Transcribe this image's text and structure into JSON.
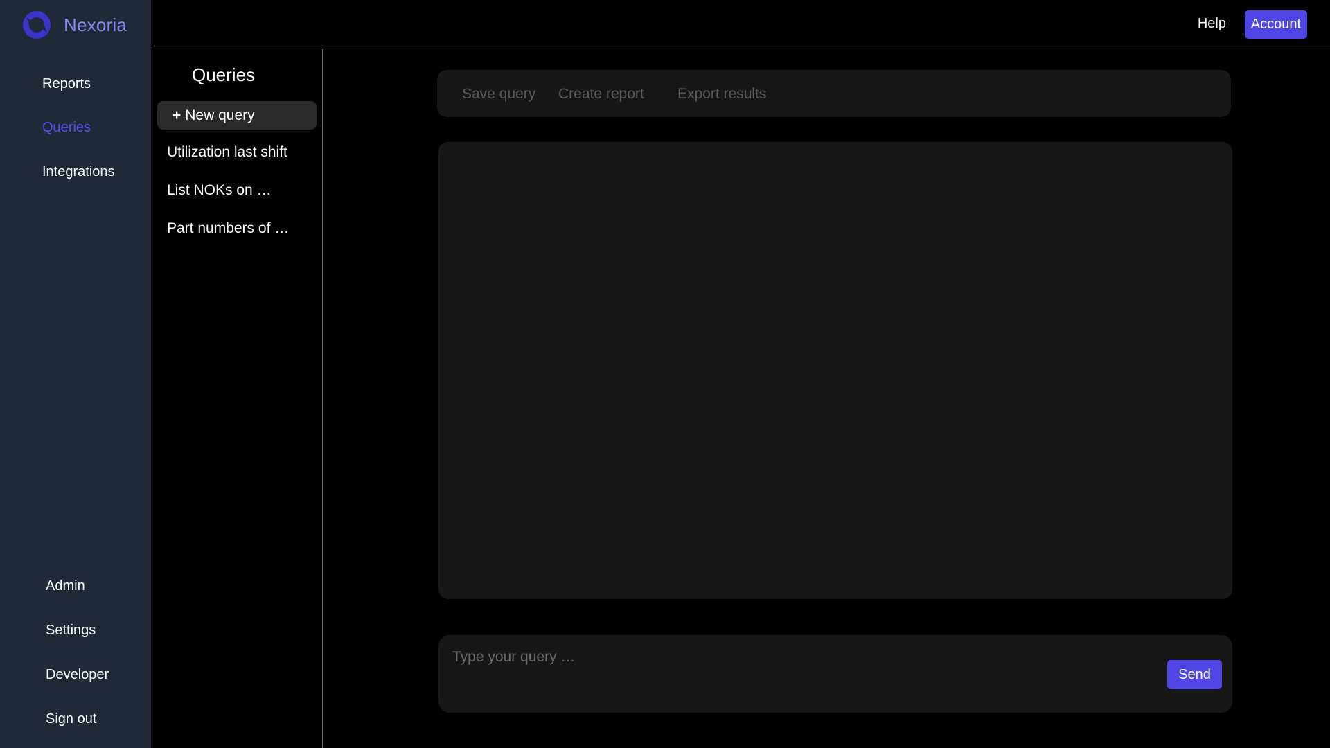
{
  "brand": {
    "name": "Nexoria",
    "logo_icon": "nexoria-logo-icon"
  },
  "sidebar": {
    "top_items": [
      {
        "label": "Reports"
      },
      {
        "label": "Queries",
        "active": true
      },
      {
        "label": "Integrations"
      }
    ],
    "bottom_items": [
      {
        "label": "Admin"
      },
      {
        "label": "Settings"
      },
      {
        "label": "Developer"
      },
      {
        "label": "Sign out"
      }
    ]
  },
  "header": {
    "help_label": "Help",
    "account_label": "Account"
  },
  "queries_panel": {
    "title": "Queries",
    "new_query_plus": "+",
    "new_query_label": "New query",
    "items": [
      {
        "label": "Utilization last shift"
      },
      {
        "label": "List NOKs on …"
      },
      {
        "label": "Part numbers of …"
      }
    ]
  },
  "toolbar": {
    "save_label": "Save query",
    "create_report_label": "Create report",
    "export_label": "Export results"
  },
  "composer": {
    "placeholder": "Type your query …",
    "send_label": "Send"
  },
  "colors": {
    "accent": "#4f46e5",
    "sidebar_bg": "#212838",
    "active_nav": "#5a4ff0",
    "panel_bg": "#171717"
  }
}
